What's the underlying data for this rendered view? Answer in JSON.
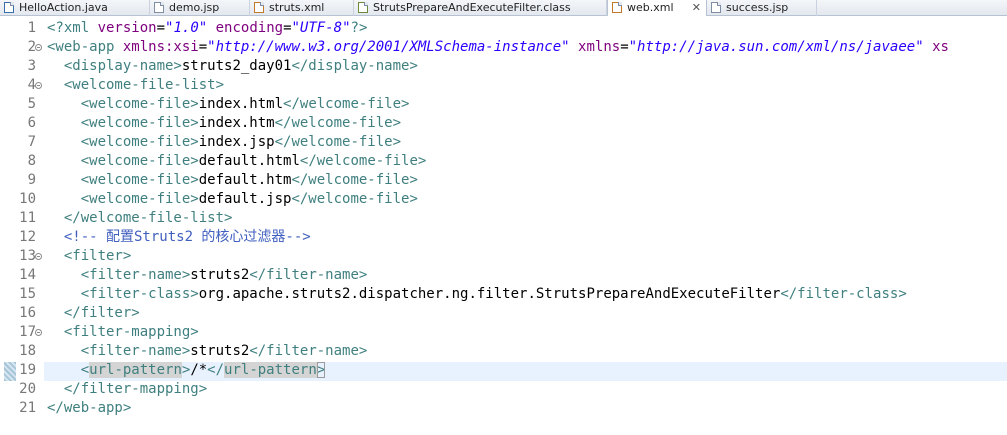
{
  "tabs": [
    {
      "label": "HelloAction.java",
      "icon": "java-file-icon",
      "active": false
    },
    {
      "label": "demo.jsp",
      "icon": "jsp-file-icon",
      "active": false
    },
    {
      "label": "struts.xml",
      "icon": "xml-file-icon",
      "active": false
    },
    {
      "label": "StrutsPrepareAndExecuteFilter.class",
      "icon": "class-file-icon",
      "active": false
    },
    {
      "label": "web.xml",
      "icon": "xml-file-icon",
      "active": true,
      "close": "✕"
    },
    {
      "label": "success.jsp",
      "icon": "jsp-file-icon",
      "active": false
    }
  ],
  "editor": {
    "file": "web.xml",
    "current_line": 19,
    "lines": [
      {
        "n": "1",
        "fold": false,
        "tokens": [
          [
            "t-tag",
            "<?xml "
          ],
          [
            "t-attr",
            "version"
          ],
          [
            "t-txt",
            "="
          ],
          [
            "t-val",
            "\"1.0\""
          ],
          [
            "t-txt",
            " "
          ],
          [
            "t-attr",
            "encoding"
          ],
          [
            "t-txt",
            "="
          ],
          [
            "t-val",
            "\"UTF-8\""
          ],
          [
            "t-tag",
            "?>"
          ]
        ]
      },
      {
        "n": "2",
        "fold": true,
        "tokens": [
          [
            "t-tag",
            "<web-app "
          ],
          [
            "t-attr",
            "xmlns:xsi"
          ],
          [
            "t-txt",
            "="
          ],
          [
            "t-val",
            "\"http://www.w3.org/2001/XMLSchema-instance\""
          ],
          [
            "t-txt",
            " "
          ],
          [
            "t-attr",
            "xmlns"
          ],
          [
            "t-txt",
            "="
          ],
          [
            "t-val",
            "\"http://java.sun.com/xml/ns/javaee\""
          ],
          [
            "t-txt",
            " "
          ],
          [
            "t-attr",
            "xs"
          ]
        ]
      },
      {
        "n": "3",
        "fold": false,
        "tokens": [
          [
            "t-txt",
            "  "
          ],
          [
            "t-tag",
            "<display-name>"
          ],
          [
            "t-txt",
            "struts2_day01"
          ],
          [
            "t-tag",
            "</display-name>"
          ]
        ]
      },
      {
        "n": "4",
        "fold": true,
        "tokens": [
          [
            "t-txt",
            "  "
          ],
          [
            "t-tag",
            "<welcome-file-list>"
          ]
        ]
      },
      {
        "n": "5",
        "fold": false,
        "tokens": [
          [
            "t-txt",
            "    "
          ],
          [
            "t-tag",
            "<welcome-file>"
          ],
          [
            "t-txt",
            "index.html"
          ],
          [
            "t-tag",
            "</welcome-file>"
          ]
        ]
      },
      {
        "n": "6",
        "fold": false,
        "tokens": [
          [
            "t-txt",
            "    "
          ],
          [
            "t-tag",
            "<welcome-file>"
          ],
          [
            "t-txt",
            "index.htm"
          ],
          [
            "t-tag",
            "</welcome-file>"
          ]
        ]
      },
      {
        "n": "7",
        "fold": false,
        "tokens": [
          [
            "t-txt",
            "    "
          ],
          [
            "t-tag",
            "<welcome-file>"
          ],
          [
            "t-txt",
            "index.jsp"
          ],
          [
            "t-tag",
            "</welcome-file>"
          ]
        ]
      },
      {
        "n": "8",
        "fold": false,
        "tokens": [
          [
            "t-txt",
            "    "
          ],
          [
            "t-tag",
            "<welcome-file>"
          ],
          [
            "t-txt",
            "default.html"
          ],
          [
            "t-tag",
            "</welcome-file>"
          ]
        ]
      },
      {
        "n": "9",
        "fold": false,
        "tokens": [
          [
            "t-txt",
            "    "
          ],
          [
            "t-tag",
            "<welcome-file>"
          ],
          [
            "t-txt",
            "default.htm"
          ],
          [
            "t-tag",
            "</welcome-file>"
          ]
        ]
      },
      {
        "n": "10",
        "fold": false,
        "tokens": [
          [
            "t-txt",
            "    "
          ],
          [
            "t-tag",
            "<welcome-file>"
          ],
          [
            "t-txt",
            "default.jsp"
          ],
          [
            "t-tag",
            "</welcome-file>"
          ]
        ]
      },
      {
        "n": "11",
        "fold": false,
        "tokens": [
          [
            "t-txt",
            "  "
          ],
          [
            "t-tag",
            "</welcome-file-list>"
          ]
        ]
      },
      {
        "n": "12",
        "fold": false,
        "tokens": [
          [
            "t-txt",
            "  "
          ],
          [
            "t-com",
            "<!-- 配置Struts2 的核心过滤器-->"
          ]
        ]
      },
      {
        "n": "13",
        "fold": true,
        "tokens": [
          [
            "t-txt",
            "  "
          ],
          [
            "t-tag",
            "<filter>"
          ]
        ]
      },
      {
        "n": "14",
        "fold": false,
        "tokens": [
          [
            "t-txt",
            "    "
          ],
          [
            "t-tag",
            "<filter-name>"
          ],
          [
            "t-txt",
            "struts2"
          ],
          [
            "t-tag",
            "</filter-name>"
          ]
        ]
      },
      {
        "n": "15",
        "fold": false,
        "tokens": [
          [
            "t-txt",
            "    "
          ],
          [
            "t-tag",
            "<filter-class>"
          ],
          [
            "t-txt",
            "org.apache.struts2.dispatcher.ng.filter.StrutsPrepareAndExecuteFilter"
          ],
          [
            "t-tag",
            "</filter-class>"
          ]
        ]
      },
      {
        "n": "16",
        "fold": false,
        "tokens": [
          [
            "t-txt",
            "  "
          ],
          [
            "t-tag",
            "</filter>"
          ]
        ]
      },
      {
        "n": "17",
        "fold": true,
        "tokens": [
          [
            "t-txt",
            "  "
          ],
          [
            "t-tag",
            "<filter-mapping>"
          ]
        ]
      },
      {
        "n": "18",
        "fold": false,
        "tokens": [
          [
            "t-txt",
            "    "
          ],
          [
            "t-tag",
            "<filter-name>"
          ],
          [
            "t-txt",
            "struts2"
          ],
          [
            "t-tag",
            "</filter-name>"
          ]
        ]
      },
      {
        "n": "19",
        "fold": false,
        "tokens": [
          [
            "t-txt",
            "    "
          ],
          [
            "t-tag",
            "<"
          ],
          [
            "t-tag t-sel",
            "url-pattern"
          ],
          [
            "t-tag",
            ">"
          ],
          [
            "t-txt",
            "/*"
          ],
          [
            "t-tag",
            "</"
          ],
          [
            "t-tag t-sel",
            "url-pattern"
          ],
          [
            "t-tag t-box",
            ">"
          ]
        ]
      },
      {
        "n": "20",
        "fold": false,
        "tokens": [
          [
            "t-txt",
            "  "
          ],
          [
            "t-tag",
            "</filter-mapping>"
          ]
        ]
      },
      {
        "n": "21",
        "fold": false,
        "tokens": [
          [
            "t-tag",
            "</web-app>"
          ]
        ]
      }
    ]
  },
  "colors": {
    "tag": "#3f7f7f",
    "attribute": "#7f007f",
    "value": "#2a00ff",
    "comment": "#3f5fbf",
    "current_line": "#e8f2fe"
  }
}
